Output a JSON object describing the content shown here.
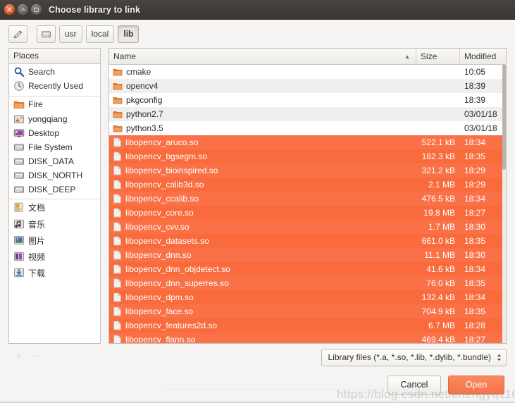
{
  "window": {
    "title": "Choose library to link",
    "controls": [
      {
        "name": "close-button",
        "glyph": "✕"
      },
      {
        "name": "minimize-button",
        "glyph": "−"
      },
      {
        "name": "maximize-button",
        "glyph": "□"
      }
    ]
  },
  "toolbar": {
    "edit_path_label": "✎",
    "drive_label": "",
    "path_buttons": [
      {
        "label": "usr",
        "active": false
      },
      {
        "label": "local",
        "active": false
      },
      {
        "label": "lib",
        "active": true
      }
    ]
  },
  "sidebar": {
    "header": "Places",
    "items": [
      {
        "label": "Search",
        "icon": "search-icon"
      },
      {
        "label": "Recently Used",
        "icon": "recent-icon"
      },
      {
        "label": "Fire",
        "icon": "folder-icon"
      },
      {
        "label": "yongqiang",
        "icon": "home-icon"
      },
      {
        "label": "Desktop",
        "icon": "desktop-icon"
      },
      {
        "label": "File System",
        "icon": "drive-icon"
      },
      {
        "label": "DISK_DATA",
        "icon": "drive-icon"
      },
      {
        "label": "DISK_NORTH",
        "icon": "drive-icon"
      },
      {
        "label": "DISK_DEEP",
        "icon": "drive-icon"
      },
      {
        "label": "文档",
        "icon": "documents-icon"
      },
      {
        "label": "音乐",
        "icon": "music-icon"
      },
      {
        "label": "图片",
        "icon": "pictures-icon"
      },
      {
        "label": "视频",
        "icon": "videos-icon"
      },
      {
        "label": "下载",
        "icon": "downloads-icon"
      }
    ]
  },
  "filelist": {
    "columns": {
      "name": "Name",
      "size": "Size",
      "modified": "Modified"
    },
    "sort_indicator": "▲",
    "rows": [
      {
        "name": "cmake",
        "size": "",
        "modified": "10:05",
        "type": "folder",
        "selected": false
      },
      {
        "name": "opencv4",
        "size": "",
        "modified": "18:39",
        "type": "folder",
        "selected": false
      },
      {
        "name": "pkgconfig",
        "size": "",
        "modified": "18:39",
        "type": "folder",
        "selected": false
      },
      {
        "name": "python2.7",
        "size": "",
        "modified": "03/01/18",
        "type": "folder",
        "selected": false
      },
      {
        "name": "python3.5",
        "size": "",
        "modified": "03/01/18",
        "type": "folder",
        "selected": false
      },
      {
        "name": "libopencv_aruco.so",
        "size": "522.1 kB",
        "modified": "18:34",
        "type": "file",
        "selected": true
      },
      {
        "name": "libopencv_bgsegm.so",
        "size": "182.3 kB",
        "modified": "18:35",
        "type": "file",
        "selected": true
      },
      {
        "name": "libopencv_bioinspired.so",
        "size": "321.2 kB",
        "modified": "18:29",
        "type": "file",
        "selected": true
      },
      {
        "name": "libopencv_calib3d.so",
        "size": "2.1 MB",
        "modified": "18:29",
        "type": "file",
        "selected": true
      },
      {
        "name": "libopencv_ccalib.so",
        "size": "476.5 kB",
        "modified": "18:34",
        "type": "file",
        "selected": true
      },
      {
        "name": "libopencv_core.so",
        "size": "19.8 MB",
        "modified": "18:27",
        "type": "file",
        "selected": true
      },
      {
        "name": "libopencv_cvv.so",
        "size": "1.7 MB",
        "modified": "18:30",
        "type": "file",
        "selected": true
      },
      {
        "name": "libopencv_datasets.so",
        "size": "661.0 kB",
        "modified": "18:35",
        "type": "file",
        "selected": true
      },
      {
        "name": "libopencv_dnn.so",
        "size": "11.1 MB",
        "modified": "18:30",
        "type": "file",
        "selected": true
      },
      {
        "name": "libopencv_dnn_objdetect.so",
        "size": "41.6 kB",
        "modified": "18:34",
        "type": "file",
        "selected": true
      },
      {
        "name": "libopencv_dnn_superres.so",
        "size": "76.0 kB",
        "modified": "18:35",
        "type": "file",
        "selected": true
      },
      {
        "name": "libopencv_dpm.so",
        "size": "132.4 kB",
        "modified": "18:34",
        "type": "file",
        "selected": true
      },
      {
        "name": "libopencv_face.so",
        "size": "704.9 kB",
        "modified": "18:35",
        "type": "file",
        "selected": true
      },
      {
        "name": "libopencv_features2d.so",
        "size": "6.7 MB",
        "modified": "18:28",
        "type": "file",
        "selected": true
      },
      {
        "name": "libopencv_flann.so",
        "size": "469.4 kB",
        "modified": "18:27",
        "type": "file",
        "selected": true
      }
    ]
  },
  "bottom": {
    "add_label": "+",
    "remove_label": "−",
    "filter_value": "Library files (*.a, *.so, *.lib, *.dylib, *.bundle)",
    "cancel_label": "Cancel",
    "open_label": "Open"
  },
  "watermark": "https://blog.csdn.net/chengyq116",
  "colors": {
    "selection": "#f96b3c",
    "selection_alt": "#fa7148",
    "primary_button": "#f4734a",
    "titlebar": "#413c39",
    "close_button": "#dd4814"
  }
}
